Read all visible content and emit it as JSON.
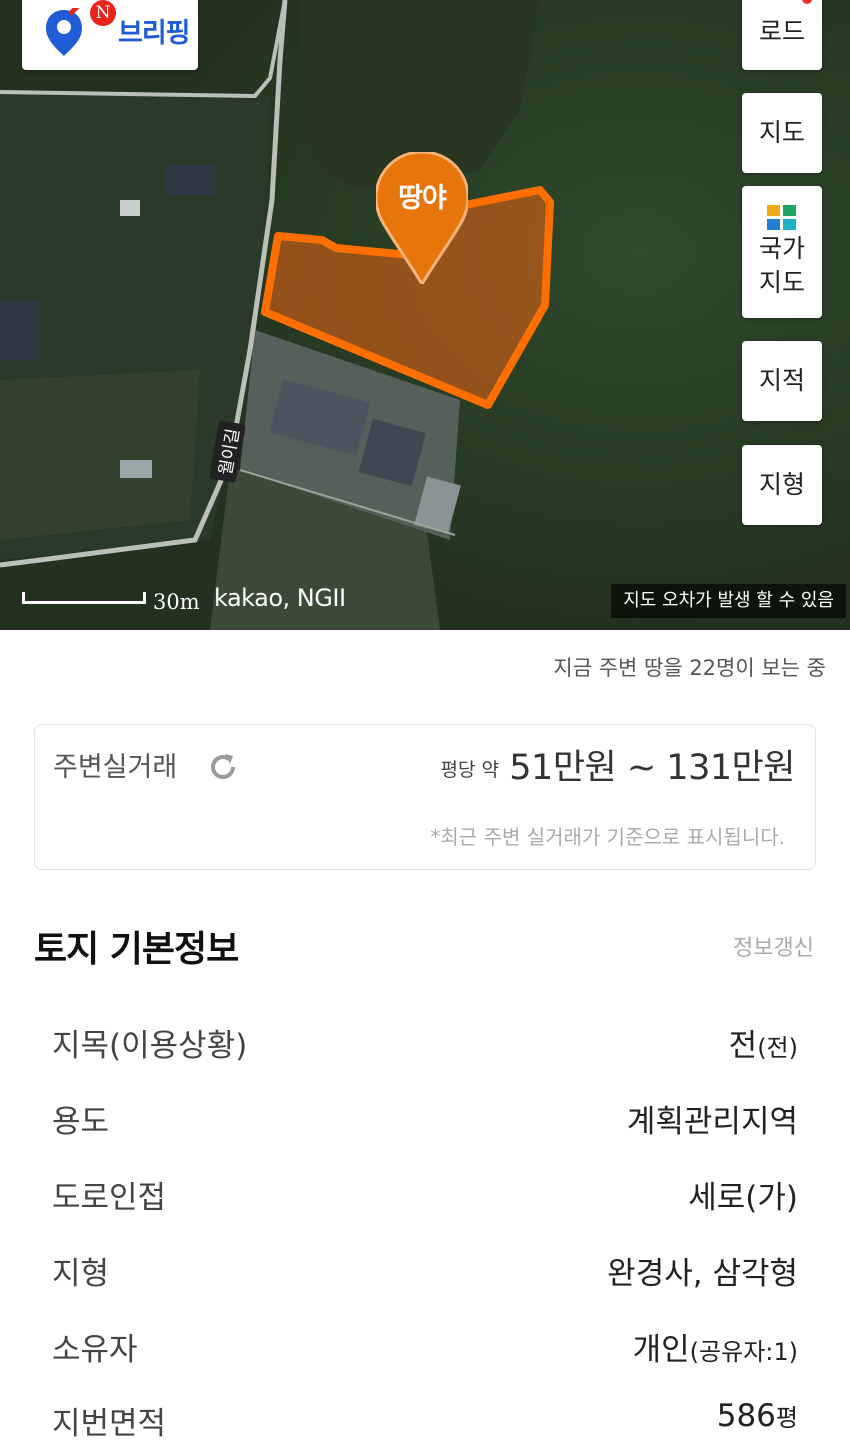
{
  "map": {
    "briefing": {
      "badge": "N",
      "label": "브리핑"
    },
    "side_buttons": [
      {
        "label": "로드"
      },
      {
        "label": "지도"
      },
      {
        "label": "국가 지도"
      },
      {
        "label": "지적"
      },
      {
        "label": "지형"
      }
    ],
    "marker_label": "땅야",
    "road_label": "월이길",
    "scale_label": "30m",
    "copyright": "kakao, NGII",
    "disclaimer": "지도 오차가 발생 할 수 있음",
    "parcel_color": "#ff6f00"
  },
  "viewers_text": "지금 주변 땅을 22명이 보는 중",
  "trade": {
    "title": "주변실거래",
    "price_prefix": "평당 약",
    "price_range": "51만원 ~ 131만원",
    "note": "*최근 주변 실거래가 기준으로 표시됩니다."
  },
  "land_info": {
    "title": "토지 기본정보",
    "refresh_label": "정보갱신",
    "rows": [
      {
        "key": "지목(이용상황)",
        "value": "전",
        "suffix": "(전)"
      },
      {
        "key": "용도",
        "value": "계획관리지역",
        "suffix": ""
      },
      {
        "key": "도로인접",
        "value": "세로(가)",
        "suffix": ""
      },
      {
        "key": "지형",
        "value": "완경사, 삼각형",
        "suffix": ""
      },
      {
        "key": "소유자",
        "value": "개인",
        "suffix": "(공유자:1)"
      },
      {
        "key": "지번면적",
        "value": "586",
        "suffix": "평"
      }
    ]
  },
  "colors": {
    "accent": "#1f5cd6",
    "marker": "#e8750c",
    "badge": "#e8231c"
  }
}
